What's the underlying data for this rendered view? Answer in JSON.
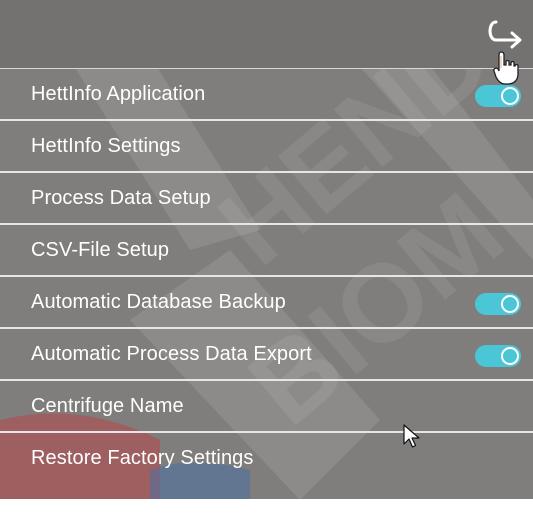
{
  "colors": {
    "panel": "#7f7e7c",
    "header": "#737270",
    "divider": "#e6e6e6",
    "toggle_on": "#4bc6d6",
    "text": "#ffffff"
  },
  "header": {
    "back_icon": "return-arrow-icon"
  },
  "menu": {
    "items": [
      {
        "label": "HettInfo Application",
        "has_toggle": true,
        "toggle_on": true
      },
      {
        "label": "HettInfo Settings",
        "has_toggle": false
      },
      {
        "label": "Process Data Setup",
        "has_toggle": false
      },
      {
        "label": "CSV-File Setup",
        "has_toggle": false
      },
      {
        "label": "Automatic Database Backup",
        "has_toggle": true,
        "toggle_on": true
      },
      {
        "label": "Automatic Process Data Export",
        "has_toggle": true,
        "toggle_on": true
      },
      {
        "label": "Centrifuge Name",
        "has_toggle": false
      },
      {
        "label": "Restore Factory Settings",
        "has_toggle": false
      }
    ]
  }
}
